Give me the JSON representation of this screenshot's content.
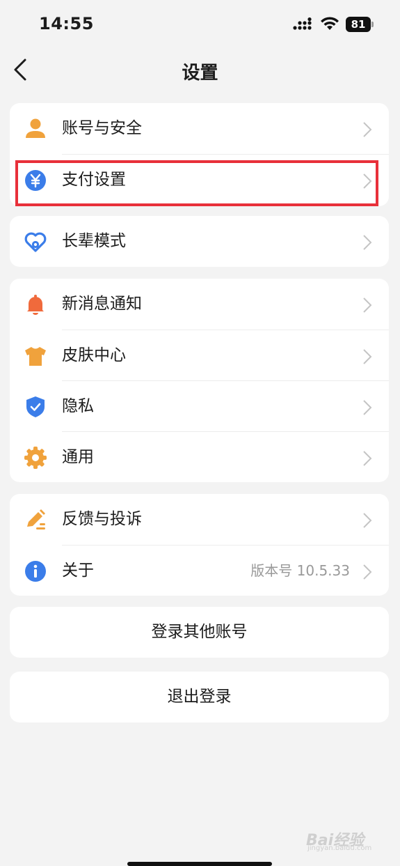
{
  "status_bar": {
    "time": "14:55",
    "battery": "81"
  },
  "nav": {
    "title": "设置"
  },
  "groups": [
    {
      "items": [
        {
          "label": "账号与安全",
          "icon": "person-icon"
        },
        {
          "label": "支付设置",
          "icon": "yuan-icon"
        }
      ]
    },
    {
      "items": [
        {
          "label": "长辈模式",
          "icon": "heart-icon"
        }
      ]
    },
    {
      "items": [
        {
          "label": "新消息通知",
          "icon": "bell-icon"
        },
        {
          "label": "皮肤中心",
          "icon": "shirt-icon"
        },
        {
          "label": "隐私",
          "icon": "shield-icon"
        },
        {
          "label": "通用",
          "icon": "gear-icon"
        }
      ]
    },
    {
      "items": [
        {
          "label": "反馈与投诉",
          "icon": "pencil-icon"
        },
        {
          "label": "关于",
          "icon": "info-icon",
          "value": "版本号 10.5.33"
        }
      ]
    }
  ],
  "buttons": {
    "switch_account": "登录其他账号",
    "logout": "退出登录"
  },
  "watermark": {
    "text": "Bai经验",
    "sub": "jingyan.baidu.com"
  },
  "colors": {
    "highlight": "#e8303a",
    "orange": "#f0a23c",
    "blue": "#3b7de9",
    "red_orange": "#f06a3c"
  }
}
